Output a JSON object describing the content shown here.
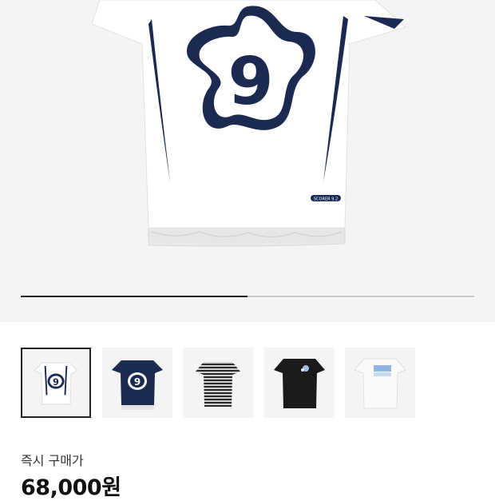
{
  "product": {
    "jersey_number": "9",
    "tag_text": "SCORER 9.2"
  },
  "gallery": {
    "progress": 0.5,
    "selected_index": 0,
    "thumbnails": [
      {
        "name": "white-jersey-9",
        "number": "9"
      },
      {
        "name": "navy-jersey-9",
        "number": "9"
      },
      {
        "name": "striped-tee"
      },
      {
        "name": "black-graphic-tee"
      },
      {
        "name": "white-graphic-tee"
      }
    ]
  },
  "pricing": {
    "label": "즉시 구매가",
    "value": "68,000원"
  },
  "colors": {
    "navy": "#1c2a52",
    "hero_bg": "#f4f4f4"
  }
}
